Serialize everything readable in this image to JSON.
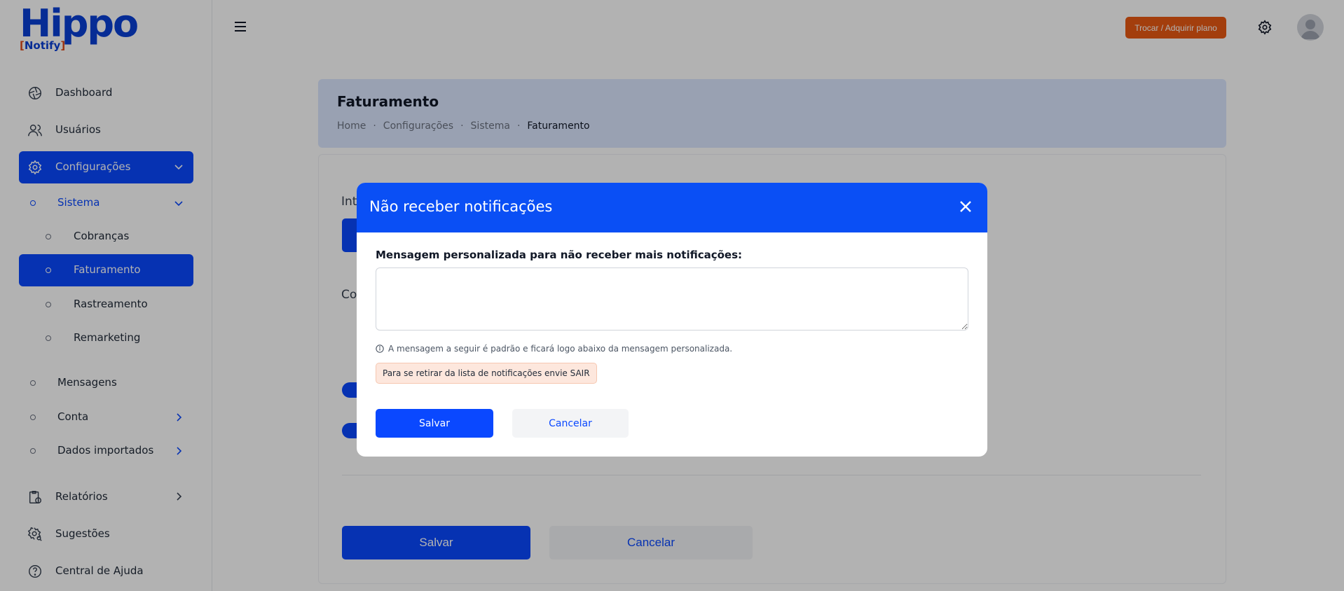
{
  "logo": {
    "main": "Hippo",
    "sub": "Notify"
  },
  "topbar": {
    "plan_button": "Trocar / Adquirir plano"
  },
  "sidebar": {
    "items": [
      {
        "label": "Dashboard"
      },
      {
        "label": "Usuários"
      },
      {
        "label": "Configurações"
      },
      {
        "label": "Sistema"
      },
      {
        "label": "Cobranças"
      },
      {
        "label": "Faturamento"
      },
      {
        "label": "Rastreamento"
      },
      {
        "label": "Remarketing"
      },
      {
        "label": "Mensagens"
      },
      {
        "label": "Conta"
      },
      {
        "label": "Dados importados"
      },
      {
        "label": "Relatórios"
      },
      {
        "label": "Sugestões"
      },
      {
        "label": "Central de Ajuda"
      }
    ]
  },
  "page": {
    "title": "Faturamento",
    "breadcrumb": [
      "Home",
      "Configurações",
      "Sistema",
      "Faturamento"
    ],
    "bg_label_1": "Int",
    "bg_label_2": "Co",
    "save_label": "Salvar",
    "cancel_label": "Cancelar"
  },
  "modal": {
    "title": "Não receber notificações",
    "field_label": "Mensagem personalizada para não receber mais notificações:",
    "field_value": "",
    "info_text": "A mensagem a seguir é padrão e ficará logo abaixo da mensagem personalizada.",
    "default_message": "Para se retirar da lista de notificações envie SAIR",
    "save_label": "Salvar",
    "cancel_label": "Cancelar"
  },
  "colors": {
    "primary": "#0a48ff",
    "accent": "#ea5a14",
    "header_bg": "#dce7ff"
  }
}
